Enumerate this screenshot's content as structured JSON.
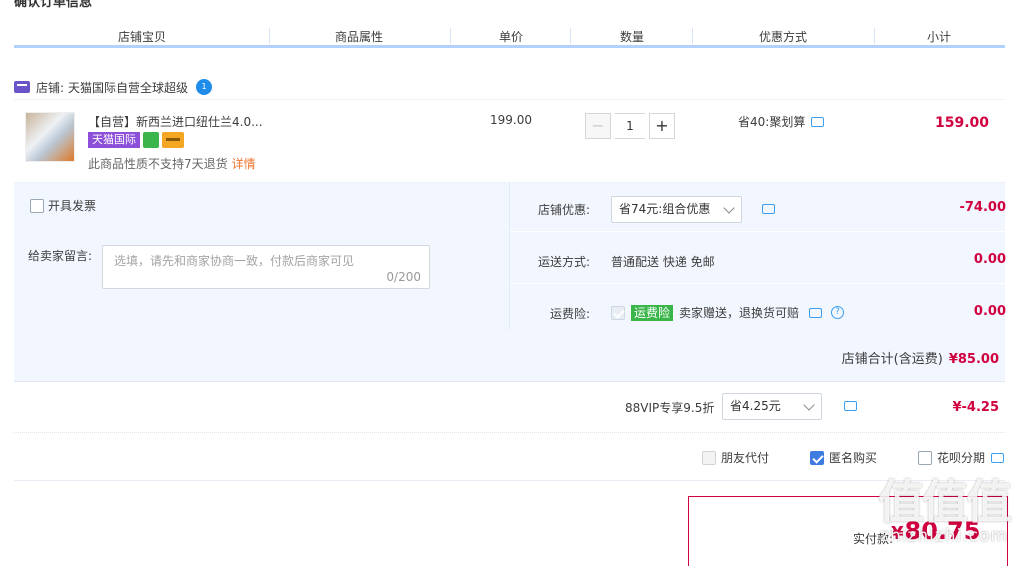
{
  "section_title": "确认订单信息",
  "columns": [
    "店铺宝贝",
    "商品属性",
    "单价",
    "数量",
    "优惠方式",
    "小计"
  ],
  "shop": {
    "prefix": "店铺:",
    "name": "天猫国际自营全球超级",
    "badge": "1"
  },
  "item": {
    "title": "【自营】新西兰进口纽仕兰4.0...",
    "tag": "天猫国际",
    "note": "此商品性质不支持7天退货",
    "note_link": "详情",
    "price": "199.00",
    "quantity": "1",
    "minus": "−",
    "plus": "+",
    "promo": "省40:聚划算",
    "subtotal": "159.00"
  },
  "invoice": {
    "label": "开具发票"
  },
  "message": {
    "label": "给卖家留言:",
    "placeholder": "选填，请先和商家协商一致，付款后商家可见",
    "counter": "0/200"
  },
  "shop_discount": {
    "label": "店铺优惠:",
    "selected": "省74元:组合优惠",
    "value": "-74.00"
  },
  "shipping": {
    "label": "运送方式:",
    "text": "普通配送 快递 免邮",
    "value": "0.00"
  },
  "insurance": {
    "label": "运费险:",
    "tag": "运费险",
    "text": "卖家赠送，退换货可赔",
    "value": "0.00"
  },
  "shop_total": {
    "label": "店铺合计(含运费)",
    "value": "¥85.00"
  },
  "vip": {
    "label": "88VIP专享9.5折",
    "selected": "省4.25元",
    "value": "¥-4.25"
  },
  "options": {
    "friend_pay": "朋友代付",
    "anonymous": "匿名购买",
    "huabei": "花呗分期"
  },
  "payment": {
    "label": "实付款:",
    "currency": "¥",
    "amount": "80.75"
  },
  "watermark": {
    "main": "值值值",
    "sub": "zhizhizhi.com"
  },
  "colors": {
    "price_red": "#d1003f",
    "accent_blue": "#3d7be0",
    "panel_bg": "#f2f7ff",
    "tmall_purple": "#8b4fd9"
  }
}
